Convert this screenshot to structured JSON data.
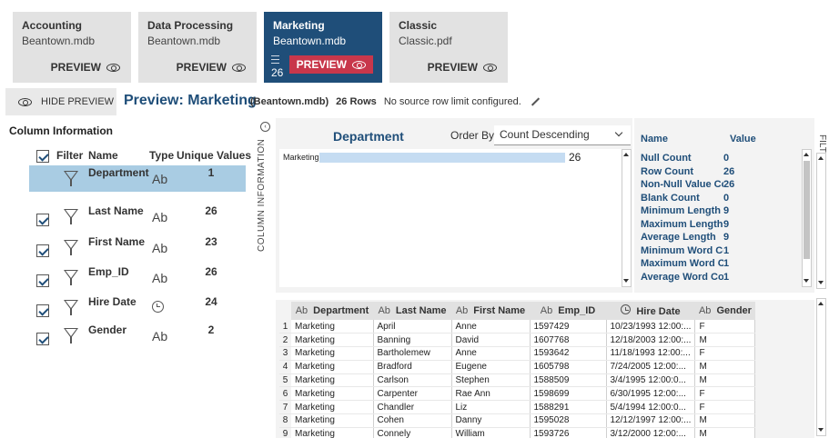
{
  "cards": [
    {
      "title": "Accounting",
      "subtitle": "Beantown.mdb",
      "preview": "PREVIEW",
      "active": false
    },
    {
      "title": "Data Processing",
      "subtitle": "Beantown.mdb",
      "preview": "PREVIEW",
      "active": false
    },
    {
      "title": "Marketing",
      "subtitle": "Beantown.mdb",
      "preview": "PREVIEW",
      "active": true,
      "count": "26"
    },
    {
      "title": "Classic",
      "subtitle": "Classic.pdf",
      "preview": "PREVIEW",
      "active": false
    }
  ],
  "preview_bar": {
    "hide_label": "HIDE PREVIEW",
    "title": "Preview: Marketing",
    "source": "(Beantown.mdb)",
    "rows": "26 Rows",
    "limit": "No source row limit configured."
  },
  "column_info": {
    "heading": "Column Information",
    "headers": {
      "filter": "Filter",
      "name": "Name",
      "type": "Type",
      "unique": "Unique Values"
    },
    "rows": [
      {
        "name": "Department",
        "type": "Ab",
        "unique": "1",
        "selected": true
      },
      {
        "name": "Last Name",
        "type": "Ab",
        "unique": "26"
      },
      {
        "name": "First Name",
        "type": "Ab",
        "unique": "23"
      },
      {
        "name": "Emp_ID",
        "type": "Ab",
        "unique": "26"
      },
      {
        "name": "Hire Date",
        "type": "clock-icon",
        "unique": "24"
      },
      {
        "name": "Gender",
        "type": "Ab",
        "unique": "2"
      }
    ]
  },
  "side_strip": {
    "label": "COLUMN INFORMATION",
    "toggle": "‹"
  },
  "department_panel": {
    "title": "Department",
    "order_by_label": "Order By",
    "order_by_value": "Count Descending",
    "bars": [
      {
        "category": "Marketing",
        "value": 26
      }
    ]
  },
  "stats": {
    "headers": {
      "name": "Name",
      "value": "Value"
    },
    "rows": [
      {
        "name": "Null Count",
        "value": "0"
      },
      {
        "name": "Row Count",
        "value": "26"
      },
      {
        "name": "Non-Null Value Count",
        "value": "26"
      },
      {
        "name": "Blank Count",
        "value": "0"
      },
      {
        "name": "Minimum Length",
        "value": "9"
      },
      {
        "name": "Maximum Length",
        "value": "9"
      },
      {
        "name": "Average Length",
        "value": "9"
      },
      {
        "name": "Minimum Word Count",
        "value": "1"
      },
      {
        "name": "Maximum Word Count",
        "value": "1"
      },
      {
        "name": "Average Word Count",
        "value": "1"
      }
    ]
  },
  "filters_label": "FILTERS",
  "grid": {
    "columns": [
      {
        "type": "Ab",
        "label": "Department"
      },
      {
        "type": "Ab",
        "label": "Last Name"
      },
      {
        "type": "Ab",
        "label": "First Name"
      },
      {
        "type": "Ab",
        "label": "Emp_ID"
      },
      {
        "type": "clock-icon",
        "label": "Hire Date"
      },
      {
        "type": "Ab",
        "label": "Gender"
      }
    ],
    "rows": [
      [
        "1",
        "Marketing",
        "April",
        "Anne",
        "1597429",
        "10/23/1993 12:00:...",
        "F"
      ],
      [
        "2",
        "Marketing",
        "Banning",
        "David",
        "1607768",
        "12/18/2003 12:00:...",
        "M"
      ],
      [
        "3",
        "Marketing",
        "Bartholemew",
        "Anne",
        "1593642",
        "11/18/1993 12:00:...",
        "F"
      ],
      [
        "4",
        "Marketing",
        "Bradford",
        "Eugene",
        "1605798",
        "7/24/2005 12:00:...",
        "M"
      ],
      [
        "5",
        "Marketing",
        "Carlson",
        "Stephen",
        "1588509",
        "3/4/1995 12:00:0...",
        "M"
      ],
      [
        "6",
        "Marketing",
        "Carpenter",
        "Rae Ann",
        "1598699",
        "6/30/1995 12:00:...",
        "F"
      ],
      [
        "7",
        "Marketing",
        "Chandler",
        "Liz",
        "1588291",
        "5/4/1994 12:00:0...",
        "F"
      ],
      [
        "8",
        "Marketing",
        "Cohen",
        "Danny",
        "1595028",
        "12/12/1997 12:00:...",
        "M"
      ],
      [
        "9",
        "Marketing",
        "Connely",
        "William",
        "1593726",
        "3/12/2000 12:00:...",
        "M"
      ]
    ]
  }
}
